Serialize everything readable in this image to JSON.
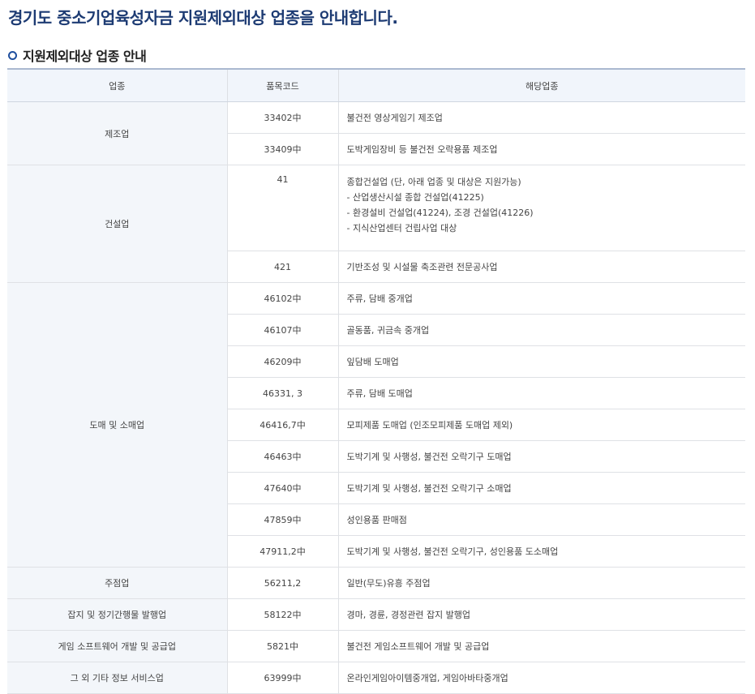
{
  "page_title": "경기도 중소기업육성자금 지원제외대상 업종을 안내합니다.",
  "section_title": "지원제외대상 업종 안내",
  "table": {
    "headers": [
      "업종",
      "품목코드",
      "해당업종"
    ],
    "groups": [
      {
        "category": "제조업",
        "rows": [
          {
            "code": "33402中",
            "desc": [
              "불건전 영상게임기 제조업"
            ]
          },
          {
            "code": "33409中",
            "desc": [
              "도박게임장비 등 불건전 오락용품 제조업"
            ]
          }
        ]
      },
      {
        "category": "건설업",
        "rows": [
          {
            "code": "41",
            "desc": [
              "종합건설업 (단, 아래 업종 및 대상은 지원가능)",
              "- 산업생산시설 종합 건설업(41225)",
              "- 환경설비 건설업(41224), 조경 건설업(41226)",
              "- 지식산업센터 건립사업 대상"
            ]
          },
          {
            "code": "421",
            "desc": [
              "기반조성 및 시설물 축조관련 전문공사업"
            ]
          }
        ]
      },
      {
        "category": "도매 및 소매업",
        "rows": [
          {
            "code": "46102中",
            "desc": [
              "주류, 담배 중개업"
            ]
          },
          {
            "code": "46107中",
            "desc": [
              "골동품, 귀금속 중개업"
            ]
          },
          {
            "code": "46209中",
            "desc": [
              "잎담배 도매업"
            ]
          },
          {
            "code": "46331, 3",
            "desc": [
              "주류, 담배 도매업"
            ]
          },
          {
            "code": "46416,7中",
            "desc": [
              "모피제품 도매업 (인조모피제품 도매업 제외)"
            ]
          },
          {
            "code": "46463中",
            "desc": [
              "도박기계 및 사행성, 불건전 오락기구 도매업"
            ]
          },
          {
            "code": "47640中",
            "desc": [
              "도박기계 및 사행성, 불건전 오락기구 소매업"
            ]
          },
          {
            "code": "47859中",
            "desc": [
              "성인용품 판매점"
            ]
          },
          {
            "code": "47911,2中",
            "desc": [
              "도박기계 및 사행성, 불건전 오락기구, 성인용품 도소매업"
            ]
          }
        ]
      },
      {
        "category": "주점업",
        "rows": [
          {
            "code": "56211,2",
            "desc": [
              "일반(무도)유흥 주점업"
            ]
          }
        ]
      },
      {
        "category": "잡지 및 정기간행물 발행업",
        "rows": [
          {
            "code": "58122中",
            "desc": [
              "경마, 경륜, 경정관련 잡지 발행업"
            ]
          }
        ]
      },
      {
        "category": "게임 소프트웨어 개발 및 공급업",
        "rows": [
          {
            "code": "5821中",
            "desc": [
              "불건전 게임소프트웨어 개발 및 공급업"
            ]
          }
        ]
      },
      {
        "category": "그 외 기타 정보 서비스업",
        "rows": [
          {
            "code": "63999中",
            "desc": [
              "온라인게임아이템중개업, 게임아바타중개업"
            ]
          }
        ]
      }
    ]
  }
}
